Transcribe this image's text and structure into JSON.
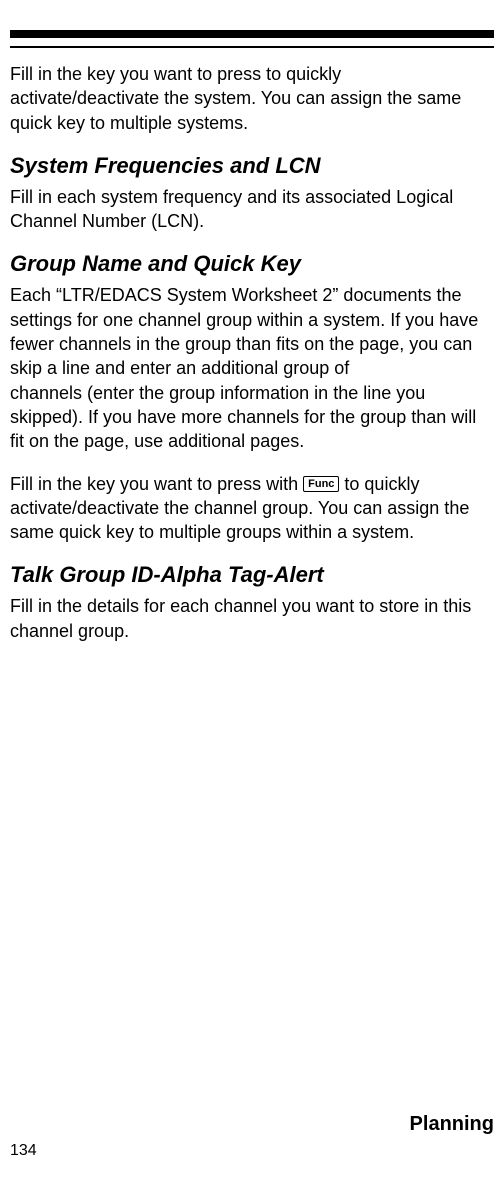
{
  "intro_text": "Fill in the key you want to press to quickly activate/deactivate the system. You can assign the same quick key to multiple systems.",
  "sections": {
    "freq": {
      "heading": "System Frequencies and LCN",
      "body": "Fill in each system frequency and its associated Logical Channel Number (LCN)."
    },
    "group": {
      "heading": "Group Name and Quick Key",
      "body1": "Each “LTR/EDACS System Worksheet 2” documents the settings for one channel group within a system. If you have fewer channels in the group than fits on the page, you can skip a line and enter an additional group of\nchannels (enter the group information in the line you skipped). If you have more channels for the group than will fit on the page, use additional pages.",
      "body2_pre": "Fill in the key you want to press with ",
      "func_label": "Func",
      "body2_post": " to quickly activate/deactivate the channel group. You can assign the same quick key to multiple groups within a system."
    },
    "talk": {
      "heading": "Talk Group ID-Alpha Tag-Alert",
      "body": "Fill in the details for each channel you want to store in this channel group."
    }
  },
  "footer": {
    "title": "Planning",
    "page": "134"
  }
}
